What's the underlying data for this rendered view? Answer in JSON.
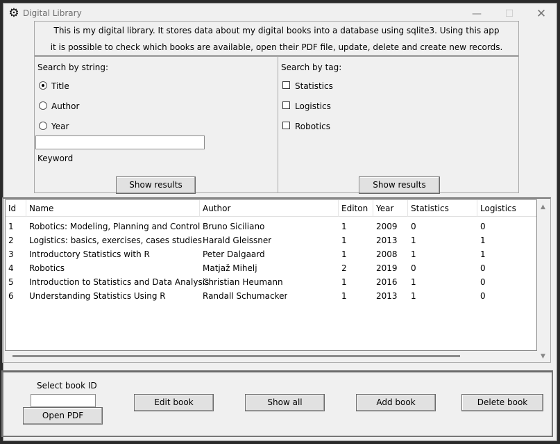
{
  "window": {
    "title": "Digital Library",
    "app_icon": "gear-icon",
    "controls": {
      "minimize": "—",
      "maximize": "☐",
      "close": "✕"
    }
  },
  "info": {
    "line1": "This is my digital library. It stores data about my digital books into a database using sqlite3. Using this app",
    "line2": "it is possible to check which books are available, open their PDF file, update, delete and create new records."
  },
  "search_string": {
    "heading": "Search by string:",
    "options": [
      {
        "label": "Title",
        "checked": true
      },
      {
        "label": "Author",
        "checked": false
      },
      {
        "label": "Year",
        "checked": false
      }
    ],
    "keyword_value": "",
    "keyword_label": "Keyword",
    "button": "Show results"
  },
  "search_tag": {
    "heading": "Search by tag:",
    "tags": [
      {
        "label": "Statistics",
        "checked": false
      },
      {
        "label": "Logistics",
        "checked": false
      },
      {
        "label": "Robotics",
        "checked": false
      }
    ],
    "button": "Show results"
  },
  "table": {
    "columns": [
      "Id",
      "Name",
      "Author",
      "Editon",
      "Year",
      "Statistics",
      "Logistics"
    ],
    "rows": [
      [
        "1",
        "Robotics: Modeling, Planning and Control",
        "Bruno Siciliano",
        "1",
        "2009",
        "0",
        "0"
      ],
      [
        "2",
        "Logistics: basics, exercises, cases studies",
        "Harald Gleissner",
        "1",
        "2013",
        "1",
        "1"
      ],
      [
        "3",
        "Introductory Statistics with R",
        "Peter Dalgaard",
        "1",
        "2008",
        "1",
        "1"
      ],
      [
        "4",
        "Robotics",
        "Matjaž Mihelj",
        "2",
        "2019",
        "0",
        "0"
      ],
      [
        "5",
        "Introduction to Statistics and Data Analysis",
        "Christian Heumann",
        "1",
        "2016",
        "1",
        "0"
      ],
      [
        "6",
        "Understanding Statistics Using R",
        "Randall Schumacker",
        "1",
        "2013",
        "1",
        "0"
      ]
    ]
  },
  "bottom": {
    "select_label": "Select book ID",
    "book_id_value": "",
    "open_pdf": "Open PDF",
    "edit_book": "Edit book",
    "show_all": "Show all",
    "add_book": "Add book",
    "delete_book": "Delete book"
  }
}
